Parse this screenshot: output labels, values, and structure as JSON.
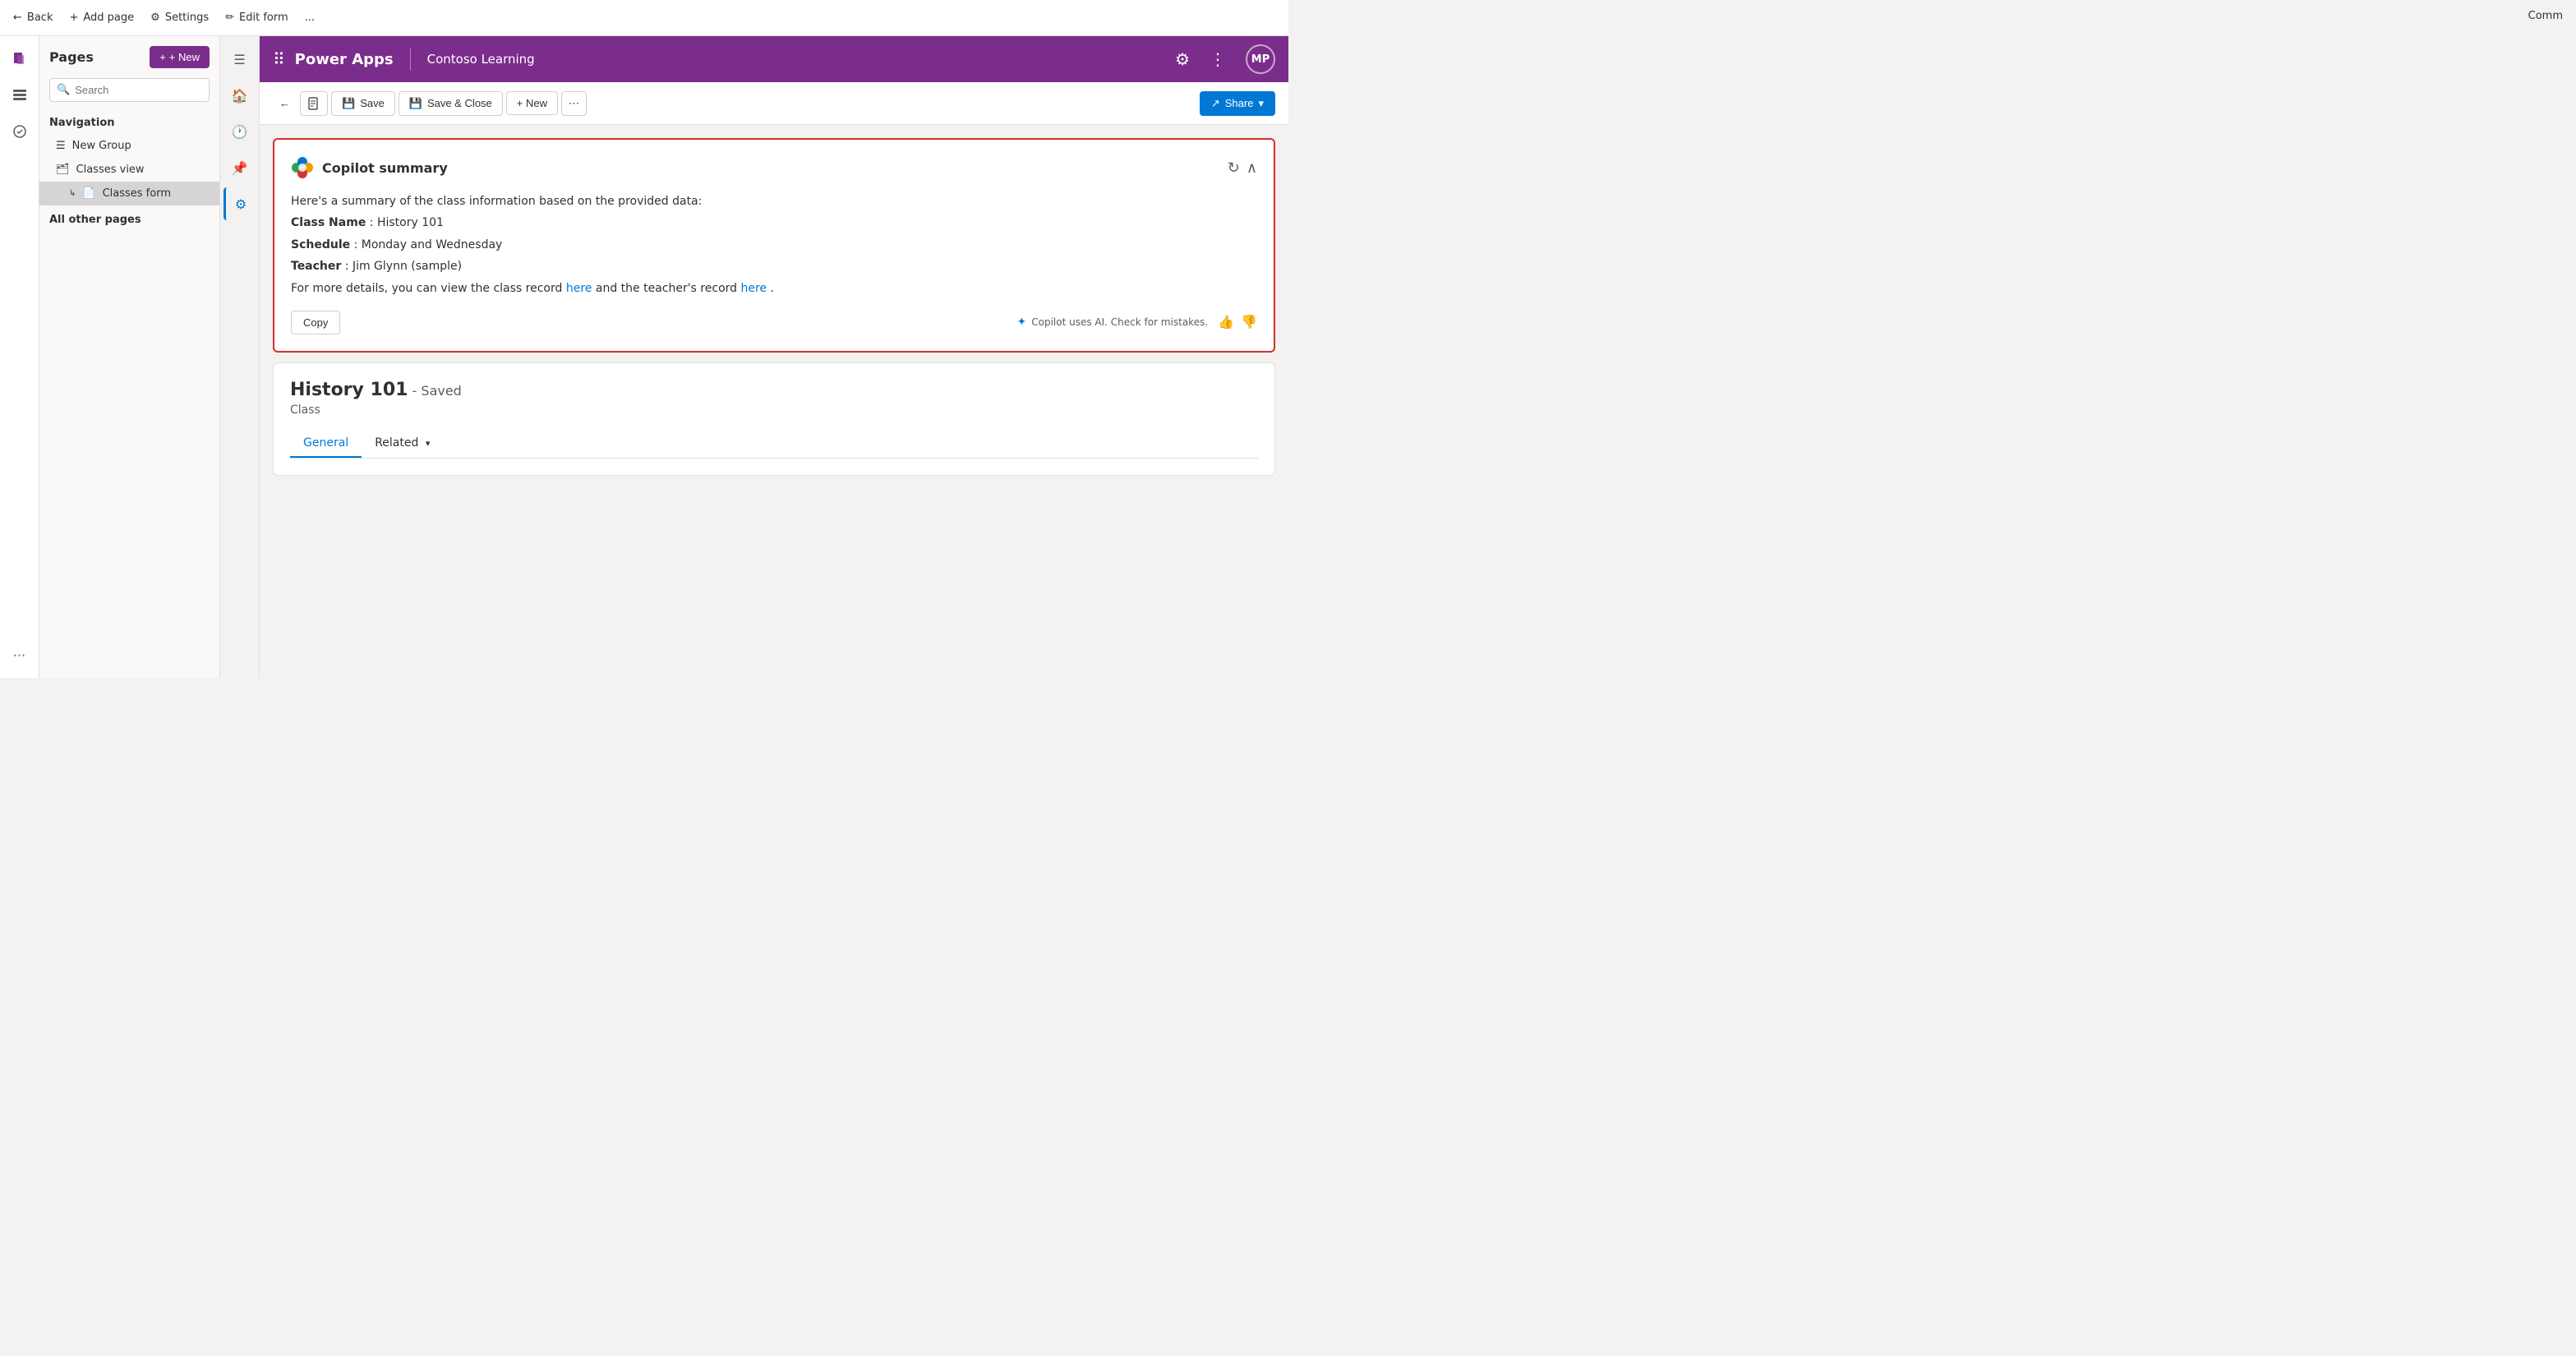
{
  "topbar": {
    "back_label": "Back",
    "add_page_label": "Add page",
    "settings_label": "Settings",
    "edit_form_label": "Edit form",
    "more_label": "..."
  },
  "sidebar": {
    "title": "Pages",
    "new_button": "+ New",
    "search_placeholder": "Search",
    "navigation_label": "Navigation",
    "new_group_label": "New Group",
    "nav_items": [
      {
        "label": "Classes view",
        "icon": "🗂"
      },
      {
        "label": "Classes form",
        "icon": "📄",
        "active": true
      }
    ],
    "all_other_pages_label": "All other pages"
  },
  "header": {
    "app_name": "Power Apps",
    "app_subtitle": "Contoso Learning",
    "avatar_initials": "MP"
  },
  "toolbar": {
    "save_label": "Save",
    "save_close_label": "Save & Close",
    "new_label": "+ New",
    "share_label": "Share"
  },
  "copilot": {
    "title": "Copilot summary",
    "body_intro": "Here's a summary of the class information based on the provided data:",
    "class_name_label": "Class Name",
    "class_name_value": "History 101",
    "schedule_label": "Schedule",
    "schedule_value": "Monday and Wednesday",
    "teacher_label": "Teacher",
    "teacher_value": "Jim Glynn (sample)",
    "details_prefix": "For more details, you can view the class record ",
    "here_label": "here",
    "details_middle": " and the teacher's record ",
    "here2_label": "here",
    "details_suffix": ".",
    "copy_button": "Copy",
    "disclaimer": "Copilot uses AI. Check for mistakes.",
    "thumbup_icon": "👍",
    "thumbdown_icon": "👎"
  },
  "record": {
    "title": "History 101",
    "saved_label": "- Saved",
    "subtitle": "Class",
    "tabs": [
      {
        "label": "General",
        "active": true
      },
      {
        "label": "Related",
        "dropdown": true
      }
    ]
  },
  "right_nav_icons": [
    "☰",
    "🏠",
    "🕐",
    "📌",
    "⚙"
  ],
  "rail_icons": [
    "📄",
    "📊",
    "⚡"
  ]
}
